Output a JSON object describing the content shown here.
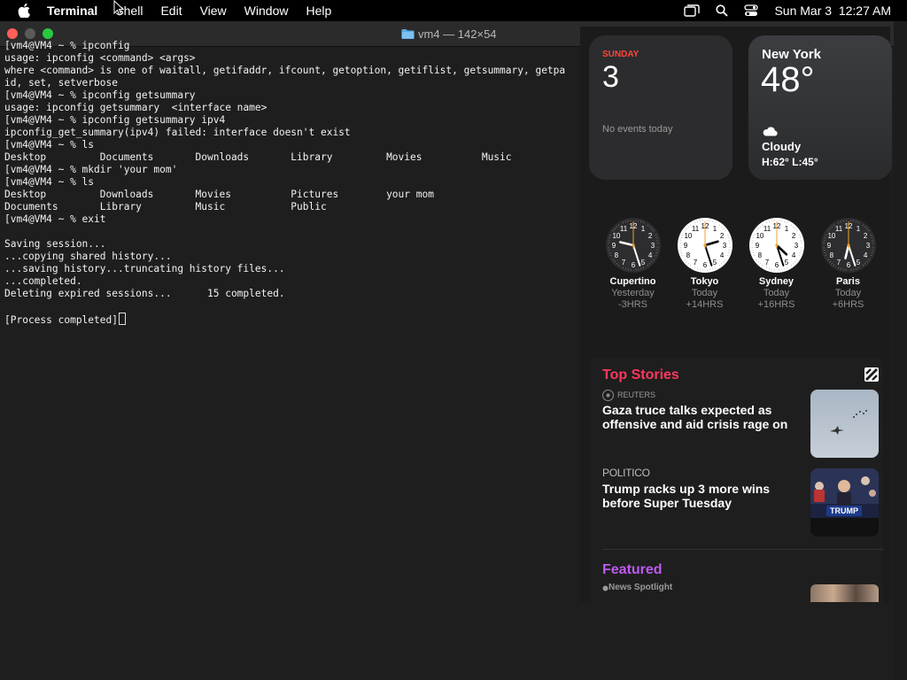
{
  "menubar": {
    "app_name": "Terminal",
    "items": [
      "Shell",
      "Edit",
      "View",
      "Window",
      "Help"
    ],
    "datetime": "Sun Mar 3  12:27 AM"
  },
  "terminal": {
    "title": "vm4 — 142×54",
    "lines": [
      "[vm4@VM4 ~ % ipconfig",
      "usage: ipconfig <command> <args>",
      "where <command> is one of waitall, getifaddr, ifcount, getoption, getiflist, getsummary, getpa",
      "id, set, setverbose",
      "[vm4@VM4 ~ % ipconfig getsummary",
      "usage: ipconfig getsummary  <interface name>",
      "[vm4@VM4 ~ % ipconfig getsummary ipv4",
      "ipconfig_get_summary(ipv4) failed: interface doesn't exist",
      "[vm4@VM4 ~ % ls",
      "Desktop         Documents       Downloads       Library         Movies          Music",
      "[vm4@VM4 ~ % mkdir 'your mom'",
      "[vm4@VM4 ~ % ls",
      "Desktop         Downloads       Movies          Pictures        your mom",
      "Documents       Library         Music           Public",
      "[vm4@VM4 ~ % exit",
      "",
      "Saving session...",
      "...copying shared history...",
      "...saving history...truncating history files...",
      "...completed.",
      "Deleting expired sessions...      15 completed.",
      "",
      "[Process completed]"
    ]
  },
  "calendar": {
    "weekday": "SUNDAY",
    "day": "3",
    "events": "No events today"
  },
  "weather": {
    "city": "New York",
    "temp": "48°",
    "condition": "Cloudy",
    "hilo": "H:62° L:45°"
  },
  "clocks": [
    {
      "city": "Cupertino",
      "day": "Yesterday",
      "offset": "-3HRS",
      "theme": "dark",
      "hour": 9,
      "minute": 27
    },
    {
      "city": "Tokyo",
      "day": "Today",
      "offset": "+14HRS",
      "theme": "light",
      "hour": 14,
      "minute": 27
    },
    {
      "city": "Sydney",
      "day": "Today",
      "offset": "+16HRS",
      "theme": "light",
      "hour": 16,
      "minute": 27
    },
    {
      "city": "Paris",
      "day": "Today",
      "offset": "+6HRS",
      "theme": "dark",
      "hour": 6,
      "minute": 27
    }
  ],
  "news": {
    "heading": "Top Stories",
    "stories": [
      {
        "source": "REUTERS",
        "title": "Gaza truce talks expected as offensive and aid crisis rage on"
      },
      {
        "source": "POLITICO",
        "title": "Trump racks up 3 more wins before Super Tuesday",
        "thumb_text": "TRUMP"
      }
    ],
    "featured_heading": "Featured",
    "featured_sub": "News Spotlight"
  },
  "colors": {
    "top_stories": "#ff375f",
    "featured": "#bf5af2",
    "calendar_accent": "#ff453a",
    "second_hand": "#f0a030"
  }
}
